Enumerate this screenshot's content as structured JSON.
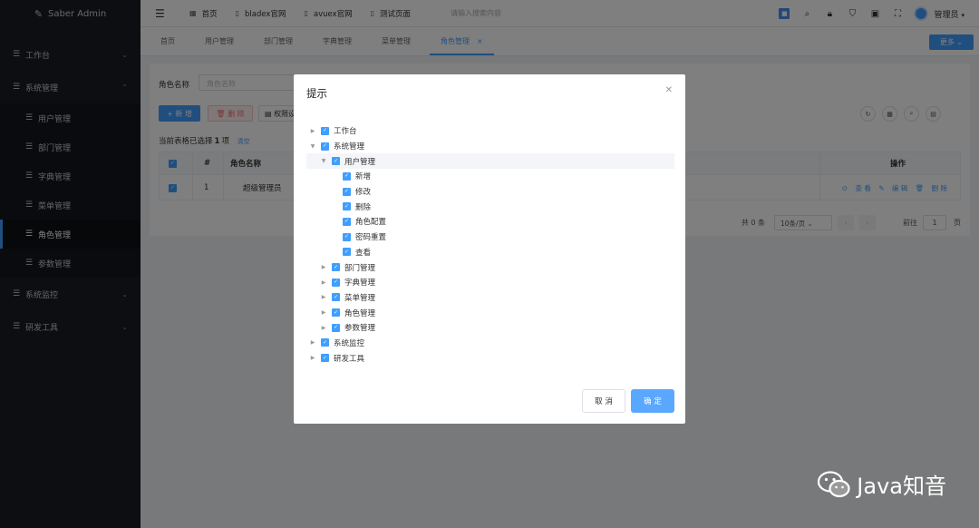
{
  "app": {
    "title": "Saber Admin"
  },
  "sidebar": {
    "items": [
      {
        "label": "工作台",
        "type": "group"
      },
      {
        "label": "系统管理",
        "type": "group-open"
      },
      {
        "label": "用户管理",
        "type": "sub"
      },
      {
        "label": "部门管理",
        "type": "sub"
      },
      {
        "label": "字典管理",
        "type": "sub"
      },
      {
        "label": "菜单管理",
        "type": "sub"
      },
      {
        "label": "角色管理",
        "type": "sub-active"
      },
      {
        "label": "参数管理",
        "type": "sub"
      },
      {
        "label": "系统监控",
        "type": "group"
      },
      {
        "label": "研发工具",
        "type": "group"
      }
    ]
  },
  "header": {
    "links": [
      "首页",
      "bladex官网",
      "avuex官网",
      "测试页面"
    ],
    "search_placeholder": "请输入搜索内容",
    "username": "管理员"
  },
  "tabs": {
    "items": [
      "首页",
      "用户管理",
      "部门管理",
      "字典管理",
      "菜单管理",
      "角色管理"
    ],
    "active_index": 5,
    "more_label": "更多"
  },
  "content": {
    "search_label": "角色名称",
    "search_placeholder": "角色名称",
    "add_label": "新 增",
    "delete_label": "删 除",
    "perm_label": "权限设",
    "selection_prefix": "当前表格已选择",
    "selection_count": "1",
    "selection_suffix": "项",
    "clear_label": "清空",
    "columns": {
      "idx": "#",
      "name": "角色名称",
      "op": "操作"
    },
    "rows": [
      {
        "idx": "1",
        "name": "超级管理员"
      }
    ],
    "row_ops": {
      "view": "查 看",
      "edit": "编 辑",
      "delete": "删 除"
    },
    "pager": {
      "total": "共 0 条",
      "page_size": "10条/页",
      "jump": "前往",
      "page": "1",
      "unit": "页"
    }
  },
  "dialog": {
    "title": "提示",
    "tree": [
      {
        "label": "工作台",
        "level": 0,
        "expand": "collapsed"
      },
      {
        "label": "系统管理",
        "level": 0,
        "expand": "expanded"
      },
      {
        "label": "用户管理",
        "level": 1,
        "expand": "expanded",
        "highlight": true
      },
      {
        "label": "新增",
        "level": 2,
        "expand": "leaf"
      },
      {
        "label": "修改",
        "level": 2,
        "expand": "leaf"
      },
      {
        "label": "删除",
        "level": 2,
        "expand": "leaf"
      },
      {
        "label": "角色配置",
        "level": 2,
        "expand": "leaf"
      },
      {
        "label": "密码重置",
        "level": 2,
        "expand": "leaf"
      },
      {
        "label": "查看",
        "level": 2,
        "expand": "leaf"
      },
      {
        "label": "部门管理",
        "level": 1,
        "expand": "collapsed"
      },
      {
        "label": "字典管理",
        "level": 1,
        "expand": "collapsed"
      },
      {
        "label": "菜单管理",
        "level": 1,
        "expand": "collapsed"
      },
      {
        "label": "角色管理",
        "level": 1,
        "expand": "collapsed"
      },
      {
        "label": "参数管理",
        "level": 1,
        "expand": "collapsed"
      },
      {
        "label": "系统监控",
        "level": 0,
        "expand": "collapsed"
      },
      {
        "label": "研发工具",
        "level": 0,
        "expand": "collapsed"
      }
    ],
    "cancel_label": "取 消",
    "ok_label": "确 定"
  },
  "watermark": {
    "text": "Java知音"
  },
  "colors": {
    "accent": "#409eff",
    "sidebar_bg": "#1b1d25",
    "danger": "#f56c6c"
  }
}
